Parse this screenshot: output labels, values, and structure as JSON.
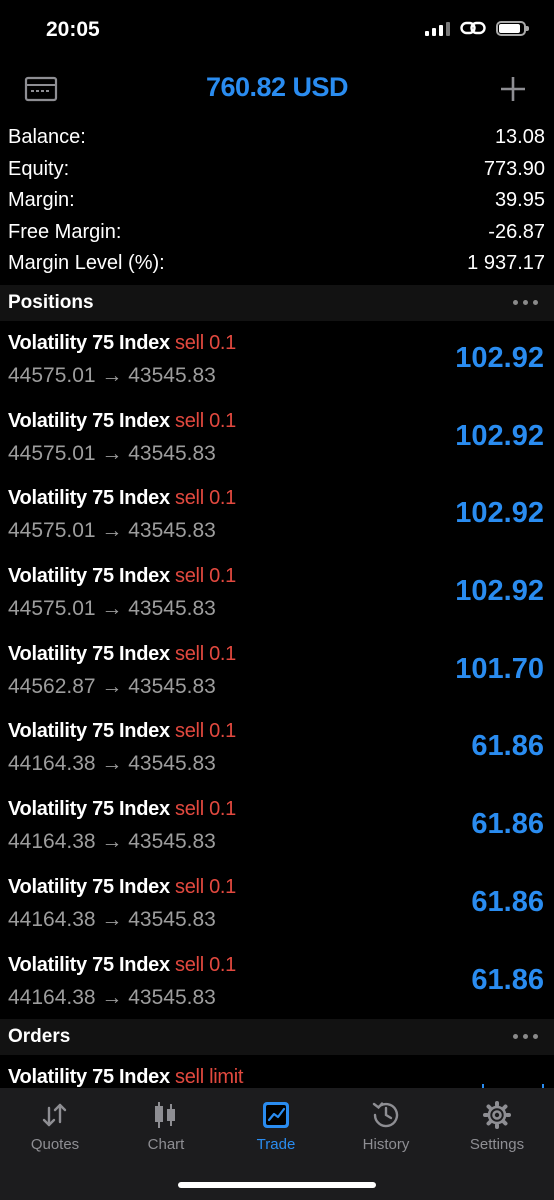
{
  "status_bar": {
    "time": "20:05",
    "battery_level": 0.9
  },
  "header": {
    "title": "760.82 USD",
    "left_icon": "card-icon",
    "right_icon": "plus-icon"
  },
  "account": [
    {
      "label": "Balance:",
      "value": "13.08"
    },
    {
      "label": "Equity:",
      "value": "773.90"
    },
    {
      "label": "Margin:",
      "value": "39.95"
    },
    {
      "label": "Free Margin:",
      "value": "-26.87"
    },
    {
      "label": "Margin Level (%):",
      "value": "1 937.17"
    }
  ],
  "positions": {
    "title": "Positions",
    "items": [
      {
        "symbol": "Volatility 75 Index",
        "side": "sell 0.1",
        "prices": "44575.01 → 43545.83",
        "profit": "102.92"
      },
      {
        "symbol": "Volatility 75 Index",
        "side": "sell 0.1",
        "prices": "44575.01 → 43545.83",
        "profit": "102.92"
      },
      {
        "symbol": "Volatility 75 Index",
        "side": "sell 0.1",
        "prices": "44575.01 → 43545.83",
        "profit": "102.92"
      },
      {
        "symbol": "Volatility 75 Index",
        "side": "sell 0.1",
        "prices": "44575.01 → 43545.83",
        "profit": "102.92"
      },
      {
        "symbol": "Volatility 75 Index",
        "side": "sell 0.1",
        "prices": "44562.87 → 43545.83",
        "profit": "101.70"
      },
      {
        "symbol": "Volatility 75 Index",
        "side": "sell 0.1",
        "prices": "44164.38 → 43545.83",
        "profit": "61.86"
      },
      {
        "symbol": "Volatility 75 Index",
        "side": "sell 0.1",
        "prices": "44164.38 → 43545.83",
        "profit": "61.86"
      },
      {
        "symbol": "Volatility 75 Index",
        "side": "sell 0.1",
        "prices": "44164.38 → 43545.83",
        "profit": "61.86"
      },
      {
        "symbol": "Volatility 75 Index",
        "side": "sell 0.1",
        "prices": "44164.38 → 43545.83",
        "profit": "61.86"
      }
    ]
  },
  "orders": {
    "title": "Orders",
    "items": [
      {
        "symbol": "Volatility 75 Index",
        "side": "sell limit"
      }
    ]
  },
  "tabs": [
    {
      "label": "Quotes",
      "icon": "quotes-icon",
      "active": false
    },
    {
      "label": "Chart",
      "icon": "chart-icon",
      "active": false
    },
    {
      "label": "Trade",
      "icon": "trade-icon",
      "active": true
    },
    {
      "label": "History",
      "icon": "history-icon",
      "active": false
    },
    {
      "label": "Settings",
      "icon": "gear-icon",
      "active": false
    }
  ],
  "colors": {
    "accent": "#2a8cf0",
    "sell": "#e2493f",
    "muted": "#9d9d9d",
    "background": "#000000",
    "tabbar": "#1c1c1e"
  }
}
